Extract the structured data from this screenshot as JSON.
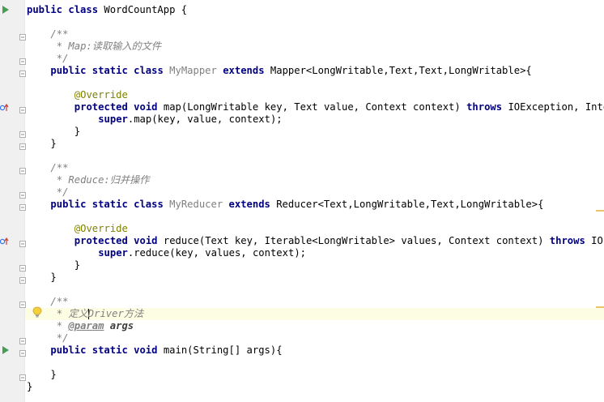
{
  "editor": {
    "lines": [
      {
        "tokens": [
          [
            "kw",
            "public class "
          ],
          [
            "cls",
            "WordCountApp "
          ],
          [
            "plain",
            "{"
          ]
        ]
      },
      {
        "tokens": []
      },
      {
        "tokens": [
          [
            "cmt",
            "/**"
          ]
        ]
      },
      {
        "tokens": [
          [
            "cmt",
            " * Map:读取输入的文件"
          ]
        ]
      },
      {
        "tokens": [
          [
            "cmt",
            " */"
          ]
        ]
      },
      {
        "tokens": [
          [
            "kw",
            "public static class "
          ],
          [
            "unused",
            "MyMapper "
          ],
          [
            "kw",
            "extends "
          ],
          [
            "plain",
            "Mapper<LongWritable,Text,Text,LongWritable>{"
          ]
        ]
      },
      {
        "tokens": []
      },
      {
        "tokens": [
          [
            "anno",
            "@Override"
          ]
        ]
      },
      {
        "tokens": [
          [
            "kw",
            "protected void "
          ],
          [
            "plain",
            "map(LongWritable key, Text value, Context context) "
          ],
          [
            "kw",
            "throws "
          ],
          [
            "plain",
            "IOException, Interrup"
          ]
        ]
      },
      {
        "tokens": [
          [
            "kw",
            "super"
          ],
          [
            "plain",
            ".map(key, value, context);"
          ]
        ]
      },
      {
        "tokens": [
          [
            "plain",
            "}"
          ]
        ]
      },
      {
        "tokens": [
          [
            "plain",
            "}"
          ]
        ]
      },
      {
        "tokens": []
      },
      {
        "tokens": [
          [
            "cmt",
            "/**"
          ]
        ]
      },
      {
        "tokens": [
          [
            "cmt",
            " * Reduce:归并操作"
          ]
        ]
      },
      {
        "tokens": [
          [
            "cmt",
            " */"
          ]
        ]
      },
      {
        "tokens": [
          [
            "kw",
            "public static class "
          ],
          [
            "unused",
            "MyReducer "
          ],
          [
            "kw",
            "extends "
          ],
          [
            "plain",
            "Reducer<Text,LongWritable,Text,LongWritable>{"
          ]
        ]
      },
      {
        "tokens": []
      },
      {
        "tokens": [
          [
            "anno",
            "@Override"
          ]
        ]
      },
      {
        "tokens": [
          [
            "kw",
            "protected void "
          ],
          [
            "plain",
            "reduce(Text key, Iterable<LongWritable> values, Context context) "
          ],
          [
            "kw",
            "throws "
          ],
          [
            "plain",
            "IOExcep"
          ]
        ]
      },
      {
        "tokens": [
          [
            "kw",
            "super"
          ],
          [
            "plain",
            ".reduce(key, values, context);"
          ]
        ]
      },
      {
        "tokens": [
          [
            "plain",
            "}"
          ]
        ]
      },
      {
        "tokens": [
          [
            "plain",
            "}"
          ]
        ]
      },
      {
        "tokens": []
      },
      {
        "tokens": [
          [
            "cmt",
            "/**"
          ]
        ]
      },
      {
        "tokens": [
          [
            "cmt",
            " * 定义"
          ],
          [
            "caret",
            ""
          ],
          [
            "cmt",
            "Driver方法"
          ]
        ]
      },
      {
        "tokens": [
          [
            "cmt",
            " * "
          ],
          [
            "doctag",
            "@param"
          ],
          [
            "cmt",
            " "
          ],
          [
            "docparam",
            "args"
          ]
        ]
      },
      {
        "tokens": [
          [
            "cmt",
            " */"
          ]
        ]
      },
      {
        "tokens": [
          [
            "kw",
            "public static void "
          ],
          [
            "plain",
            "main(String[] args){"
          ]
        ]
      },
      {
        "tokens": []
      },
      {
        "tokens": [
          [
            "plain",
            "}"
          ]
        ]
      },
      {
        "tokens": [
          [
            "plain",
            "}"
          ]
        ]
      }
    ]
  },
  "gutter": {
    "run_icon_color": "#499c54",
    "override_icon_color": "#3574f0",
    "bulb_color": "#e8b828"
  }
}
